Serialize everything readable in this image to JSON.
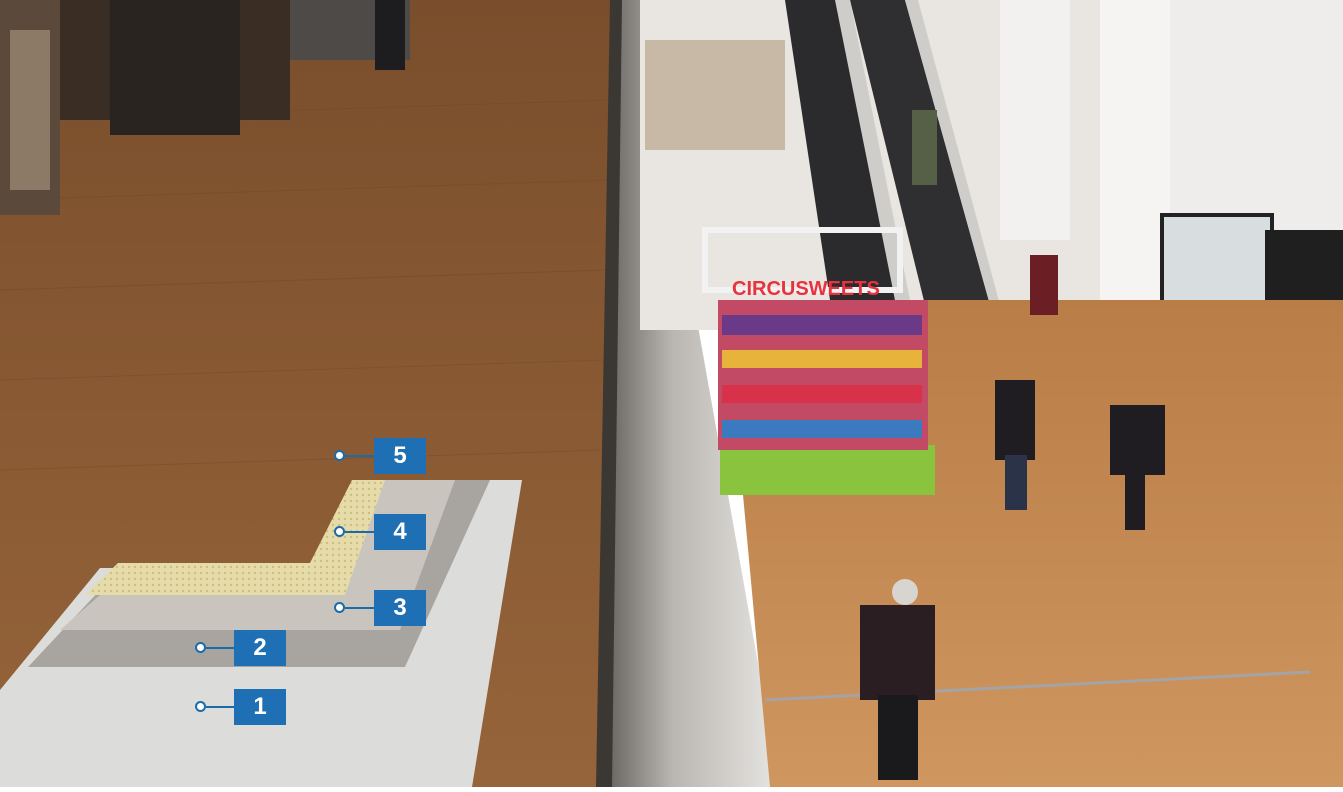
{
  "photo": {
    "sign_text": "CIRCUSWEETS",
    "colors": {
      "wood_floor_upper": "#8a5a32",
      "wood_floor_lower": "#c88c52",
      "layer_1_base": "#d9d9d7",
      "layer_2_screed": "#a9a6a1",
      "layer_3_membrane": "#c9c4be",
      "layer_4_mesh": "#e4d9a8",
      "badge": "#1e6fb3"
    }
  },
  "layers": [
    {
      "number": "1"
    },
    {
      "number": "2"
    },
    {
      "number": "3"
    },
    {
      "number": "4"
    },
    {
      "number": "5"
    }
  ]
}
